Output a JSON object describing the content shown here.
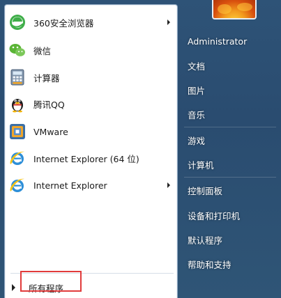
{
  "programs": [
    {
      "label": "360安全浏览器",
      "icon": "360-browser-icon",
      "has_submenu": true
    },
    {
      "label": "微信",
      "icon": "wechat-icon",
      "has_submenu": false
    },
    {
      "label": "计算器",
      "icon": "calculator-icon",
      "has_submenu": false
    },
    {
      "label": "腾讯QQ",
      "icon": "qq-penguin-icon",
      "has_submenu": false
    },
    {
      "label": "VMware",
      "icon": "vmware-icon",
      "has_submenu": false
    },
    {
      "label": "Internet Explorer (64 位)",
      "icon": "internet-explorer-icon",
      "has_submenu": false
    },
    {
      "label": "Internet Explorer",
      "icon": "internet-explorer-icon",
      "has_submenu": true
    }
  ],
  "all_programs_label": "所有程序",
  "right_items": [
    "Administrator",
    "文档",
    "图片",
    "音乐",
    "游戏",
    "计算机",
    "控制面板",
    "设备和打印机",
    "默认程序",
    "帮助和支持"
  ],
  "colors": {
    "highlight": "#e13b3b",
    "right_pane": "#2a4c70"
  }
}
